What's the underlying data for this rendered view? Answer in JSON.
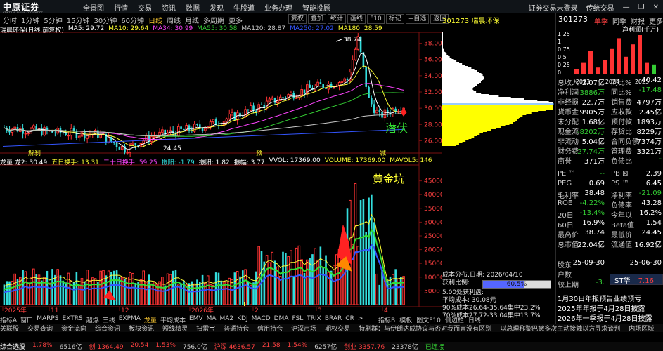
{
  "topbar": {
    "logo": "中原证券",
    "logo_sub": "CENTRAL CHINA SECURITIES",
    "menu": [
      "全景图",
      "行情",
      "交易",
      "资讯",
      "数据",
      "发现",
      "牛股道",
      "业务办理",
      "智能投顾"
    ],
    "right": [
      "证券交易未登录",
      "传统交易"
    ]
  },
  "periods": [
    "分时",
    "1分钟",
    "5分钟",
    "15分钟",
    "30分钟",
    "60分钟",
    "日线",
    "周线",
    "月线",
    "多周期",
    "更多"
  ],
  "active_period": "日线",
  "ctrl_buttons": [
    "复权",
    "叠加",
    "统计",
    "画线",
    "F10",
    "标记",
    "+自选",
    "返回"
  ],
  "stock": {
    "name": "瑞晨环保",
    "code": "301273",
    "title_line": "瑞晨环保(日线,前复权)"
  },
  "ma": [
    {
      "label": "MA5: 29.72",
      "color": "#ffffff"
    },
    {
      "label": "MA10: 29.64",
      "color": "#ffff33"
    },
    {
      "label": "MA34: 30.99",
      "color": "#ff44ff"
    },
    {
      "label": "MA55: 30.58",
      "color": "#33cc33"
    },
    {
      "label": "MA120: 28.87",
      "color": "#c8c8c8"
    },
    {
      "label": "MA250: 27.02",
      "color": "#3355ff"
    },
    {
      "label": "MA180: 28.59",
      "color": "#ffff33"
    }
  ],
  "price_axis": [
    "38.00",
    "36.00",
    "34.00",
    "32.00",
    "30.00",
    "28.00",
    "26.00"
  ],
  "price_annotations": {
    "high": "38.74",
    "low": "24.45",
    "label_right": "潜伏"
  },
  "period_labels": [
    "解刹",
    "预",
    "减"
  ],
  "indicator": {
    "line": [
      {
        "label": "龙量 龙2: 30.49",
        "color": "#ffffff"
      },
      {
        "label": "五日换手: 13.31",
        "color": "#ffff33"
      },
      {
        "label": "二十日换手: 59.25",
        "color": "#ff44ff"
      },
      {
        "label": "振阳: -1.79",
        "color": "#33dddd"
      },
      {
        "label": "振阳: 1.82",
        "color": "#ffffff"
      },
      {
        "label": "振幅: 3.77",
        "color": "#ffffff"
      },
      {
        "label": "VVOL: 17369.00",
        "color": "#ffffff"
      },
      {
        "label": "VOLUME: 17369.00",
        "color": "#ffff33"
      },
      {
        "label": "MAVOL5: 146",
        "color": "#ffff33"
      }
    ],
    "overlay_label": "黄金坑",
    "axis": [
      "45000",
      "40000",
      "35000",
      "30000",
      "25000",
      "20000",
      "15000",
      "10000",
      "5000"
    ]
  },
  "x_axis": [
    "2025年",
    "11",
    "12",
    "2026年",
    "2",
    "3",
    "4"
  ],
  "bottom_tabs": [
    "指标A",
    "窗口",
    "MARPS",
    "EXTRS",
    "超爆",
    "三线",
    "EXPMA",
    "龙量",
    "平均成本",
    "EMV",
    "MA",
    "MA2",
    "KDJ",
    "MACD",
    "DMA",
    "FSL",
    "TRIX",
    "BRAR",
    "CR",
    ">"
  ],
  "active_bottom_tab": "龙量",
  "bottom_tabs_right": [
    "指标B",
    "模板",
    "图文F10",
    "侧边栏",
    "日线"
  ],
  "func_bar": [
    "关联股",
    "交易查询",
    "资金流向",
    "综合资讯",
    "板块资讯",
    "短线精灵",
    "扫雷宝",
    "普通持仓",
    "信用持仓",
    "沪深市场",
    "期权交易",
    "特刷群：与伊朗达成协议与否对我而言没有区别",
    "以总理称黎巴嫩多次主动接触以方寻求谈判",
    "内场区域"
  ],
  "status": {
    "index1": "综合选股",
    "v1": "1.78%",
    "v2": "6516亿",
    "idx2": "创 1364.49",
    "v3": "20.54",
    "v4": "1.53%",
    "v5": "756.0亿",
    "idx3": "沪深 4636.57",
    "v6": "21.58",
    "v7": "1.54%",
    "v8": "6257亿",
    "idx4": "创业 3357.76",
    "v9": "23378亿",
    "conn": "已连接"
  },
  "chip": {
    "title": "301273 瑞晨环保",
    "date_line": "成本分布,日期: 2026/04/10",
    "profit_label": "获利比例:",
    "profit_value": "60.5%",
    "profit_fraction": 0.605,
    "lines": [
      "5.00处获利盘:",
      "平均成本: 30.08元",
      "90%成本26.64-35.64集中23.2%",
      "70%成本27.72-33.04集中13.7%"
    ]
  },
  "right_panel": {
    "code": "301273",
    "tabs": [
      "单季",
      "同季",
      "财报",
      "更多"
    ],
    "chart_title": "净利润(千万)",
    "year_labels": [
      "2023",
      "2024",
      "2025"
    ],
    "yticks": [
      "1.25",
      "1",
      "0.75",
      "0.5",
      "0.25",
      "0"
    ],
    "fin_rows": [
      [
        "总收入",
        "2.07亿",
        "同比%",
        "40.42"
      ],
      [
        "净利润",
        "-3886万",
        "同比%",
        "-17.48"
      ],
      [
        "非经损",
        "22.7万",
        "销售费",
        "4797万"
      ],
      [
        "货币金",
        "9905万",
        "应收款",
        "2.45亿"
      ],
      [
        "未分配",
        "1.68亿",
        "预付款",
        "1893万"
      ],
      [
        "现金流",
        "-8202万",
        "存货比",
        "8229万"
      ],
      [
        "非流动",
        "5.04亿",
        "合同负债",
        "7374万"
      ],
      [
        "财务费",
        "-27.74万",
        "管理费",
        "3321万"
      ],
      [
        "商誉",
        "371万",
        "负债比",
        "-"
      ]
    ],
    "val_rows": [
      [
        "PE ™",
        "--",
        "PB ⊠",
        "2.39"
      ],
      [
        "PEG",
        "0.69",
        "PS ™",
        "6.45"
      ],
      [
        "毛利率",
        "38.48",
        "净利率",
        "-21.09"
      ],
      [
        "ROE",
        "-4.22%",
        "负债率",
        "43.28"
      ],
      [
        "20日",
        "-13.4%",
        "今年以",
        "16.2%"
      ],
      [
        "60日",
        "16.9%",
        "Beta值",
        "1.54"
      ],
      [
        "最高价",
        "38.74",
        "最低价",
        "24.45"
      ],
      [
        "总市值",
        "22.04亿",
        "流通值",
        "16.92亿"
      ]
    ],
    "holder_rows": [
      [
        "股东",
        "25-09-30",
        "",
        "25-06-30"
      ],
      [
        "户数",
        "",
        "",
        ""
      ],
      [
        "较上期",
        "-3.",
        "",
        ""
      ]
    ],
    "news": [
      "1月30日年报预告业绩预亏",
      "2025年年报于4月28日披露",
      "2026年一季报于4月28日披露"
    ],
    "popup_name": "ST华",
    "popup_value": "7.16"
  },
  "colors": {
    "up": "#ff3333",
    "down": "#33dddd",
    "bg": "#000000"
  }
}
